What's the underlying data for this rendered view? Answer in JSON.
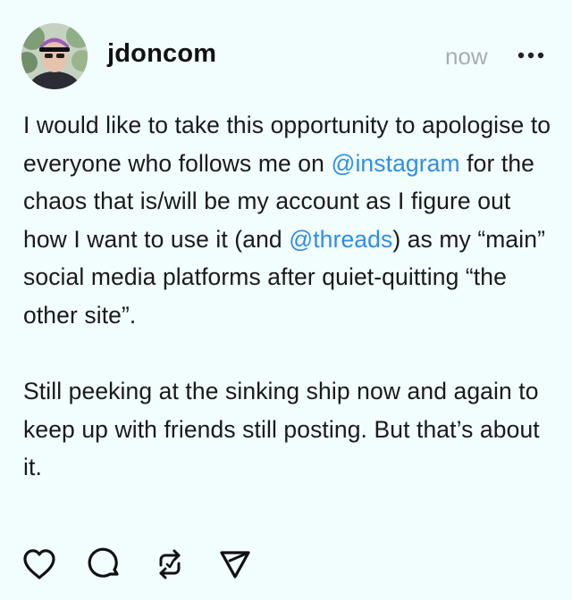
{
  "post": {
    "username": "jdoncom",
    "timestamp": "now",
    "paragraph1": {
      "t1": "I would like to take this opportunity to apologise to everyone who follows me on ",
      "mention1": "@instagram",
      "t2": " for the chaos that is/will be my account as I figure out how I want to use it (and ",
      "mention2": "@threads",
      "t3": ") as my “main” social media platforms after quiet-quitting “the other site”."
    },
    "paragraph2": "Still peeking at the sinking ship now and again to keep up with friends still posting. But that’s about it.",
    "actions": {
      "like_icon": "heart-icon",
      "comment_icon": "comment-bubble-icon",
      "repost_icon": "repost-icon",
      "share_icon": "send-icon"
    },
    "more_icon": "more-dots-icon",
    "colors": {
      "background": "#f2fdfd",
      "mention": "#2f8ee6",
      "timestamp": "#a9aeb0",
      "text": "#1a1a1a"
    }
  }
}
